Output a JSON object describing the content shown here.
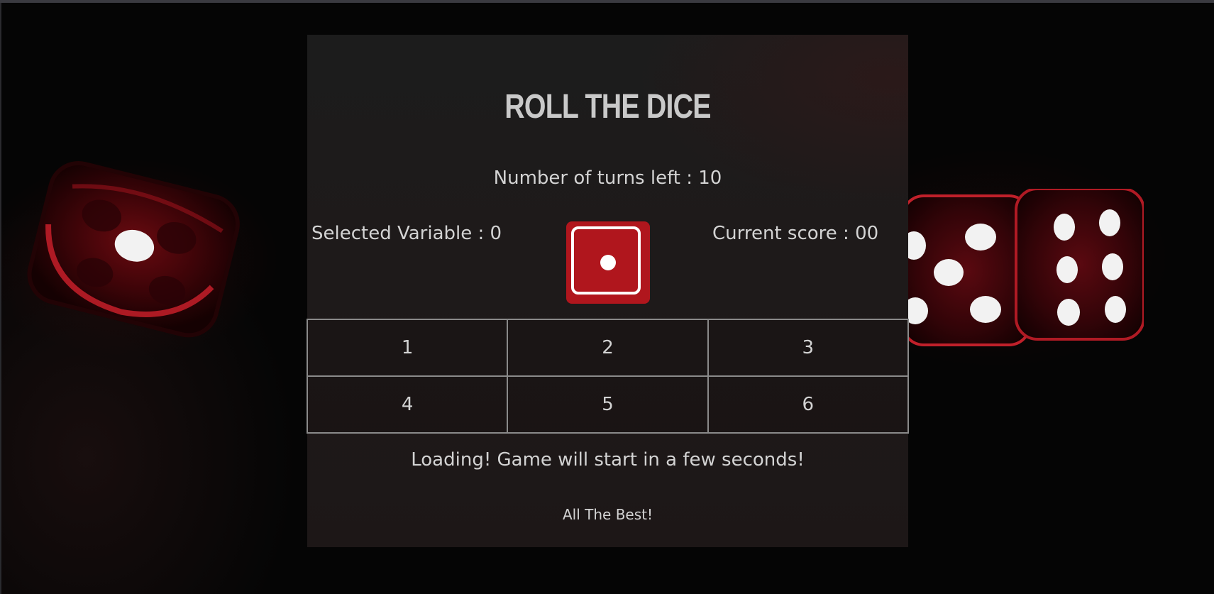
{
  "game": {
    "title": "ROLL THE DICE",
    "turns_left": "Number of turns left : 10",
    "selected_variable": "Selected Variable : 0",
    "current_score": "Current score : 00",
    "dice_face": 1,
    "number_buttons": [
      "1",
      "2",
      "3",
      "4",
      "5",
      "6"
    ],
    "status_message": "Loading! Game will start in a few seconds!",
    "footer_message": "All The Best!"
  },
  "colors": {
    "dice_red": "#b0161d",
    "panel_bg": "#1c1c1c",
    "text": "#d3d3d3",
    "title": "#c9c9c9",
    "grid_border": "#8a8a8a"
  },
  "icons": {
    "dice_button": "dice-one-icon",
    "background_left": "die-one-icon",
    "background_right": "dice-pair-icon"
  }
}
